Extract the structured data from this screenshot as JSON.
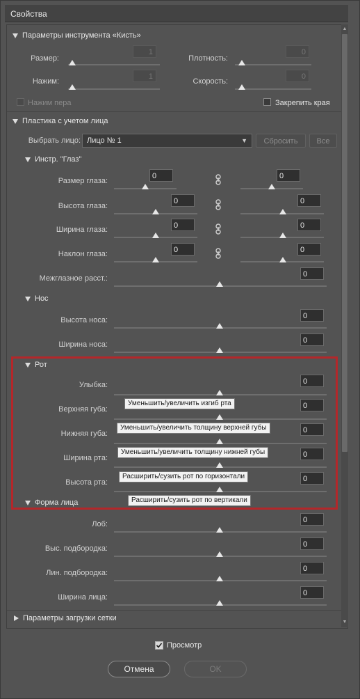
{
  "window": {
    "title": "Свойства"
  },
  "brush_section": {
    "title": "Параметры инструмента «Кисть»",
    "size_label": "Размер:",
    "size_value": "1",
    "density_label": "Плотность:",
    "density_value": "0",
    "pressure_label": "Нажим:",
    "pressure_value": "1",
    "rate_label": "Скорость:",
    "rate_value": "0",
    "pen_pressure_label": "Нажим пера",
    "pin_edges_label": "Закрепить края"
  },
  "face_section": {
    "title": "Пластика с учетом лица",
    "select_face_label": "Выбрать лицо:",
    "select_face_value": "Лицо № 1",
    "reset_label": "Сбросить",
    "all_label": "Все"
  },
  "eyes": {
    "title": "Инстр. \"Глаз\"",
    "rows": [
      {
        "label": "Размер глаза:",
        "left": "0",
        "right": "0"
      },
      {
        "label": "Высота глаза:",
        "left": "0",
        "right": "0"
      },
      {
        "label": "Ширина глаза:",
        "left": "0",
        "right": "0"
      },
      {
        "label": "Наклон глаза:",
        "left": "0",
        "right": "0"
      }
    ],
    "distance_label": "Межглазное расст.:",
    "distance_value": "0"
  },
  "nose": {
    "title": "Нос",
    "rows": [
      {
        "label": "Высота носа:",
        "value": "0"
      },
      {
        "label": "Ширина носа:",
        "value": "0"
      }
    ]
  },
  "mouth": {
    "title": "Рот",
    "rows": [
      {
        "label": "Улыбка:",
        "value": "0"
      },
      {
        "label": "Верхняя губа:",
        "value": "0"
      },
      {
        "label": "Нижняя губа:",
        "value": "0"
      },
      {
        "label": "Ширина рта:",
        "value": "0"
      },
      {
        "label": "Высота рта:",
        "value": "0"
      }
    ],
    "tooltips": [
      "Уменьшить/увеличить изгиб рта",
      "Уменьшить/увеличить толщину верхней губы",
      "Уменьшить/увеличить толщину нижней губы",
      "Расширить/сузить рот по горизонтали",
      "Расширить/сузить рот по вертикали"
    ]
  },
  "face_shape": {
    "title": "Форма лица",
    "rows": [
      {
        "label": "Лоб:",
        "value": "0"
      },
      {
        "label": "Выс. подбородка:",
        "value": "0"
      },
      {
        "label": "Лин. подбородка:",
        "value": "0"
      },
      {
        "label": "Ширина лица:",
        "value": "0"
      }
    ]
  },
  "mesh_section": {
    "title": "Параметры загрузки сетки"
  },
  "footer": {
    "preview_label": "Просмотр",
    "cancel_label": "Отмена",
    "ok_label": "OK"
  },
  "colors": {
    "highlight_box": "#b4272a"
  }
}
